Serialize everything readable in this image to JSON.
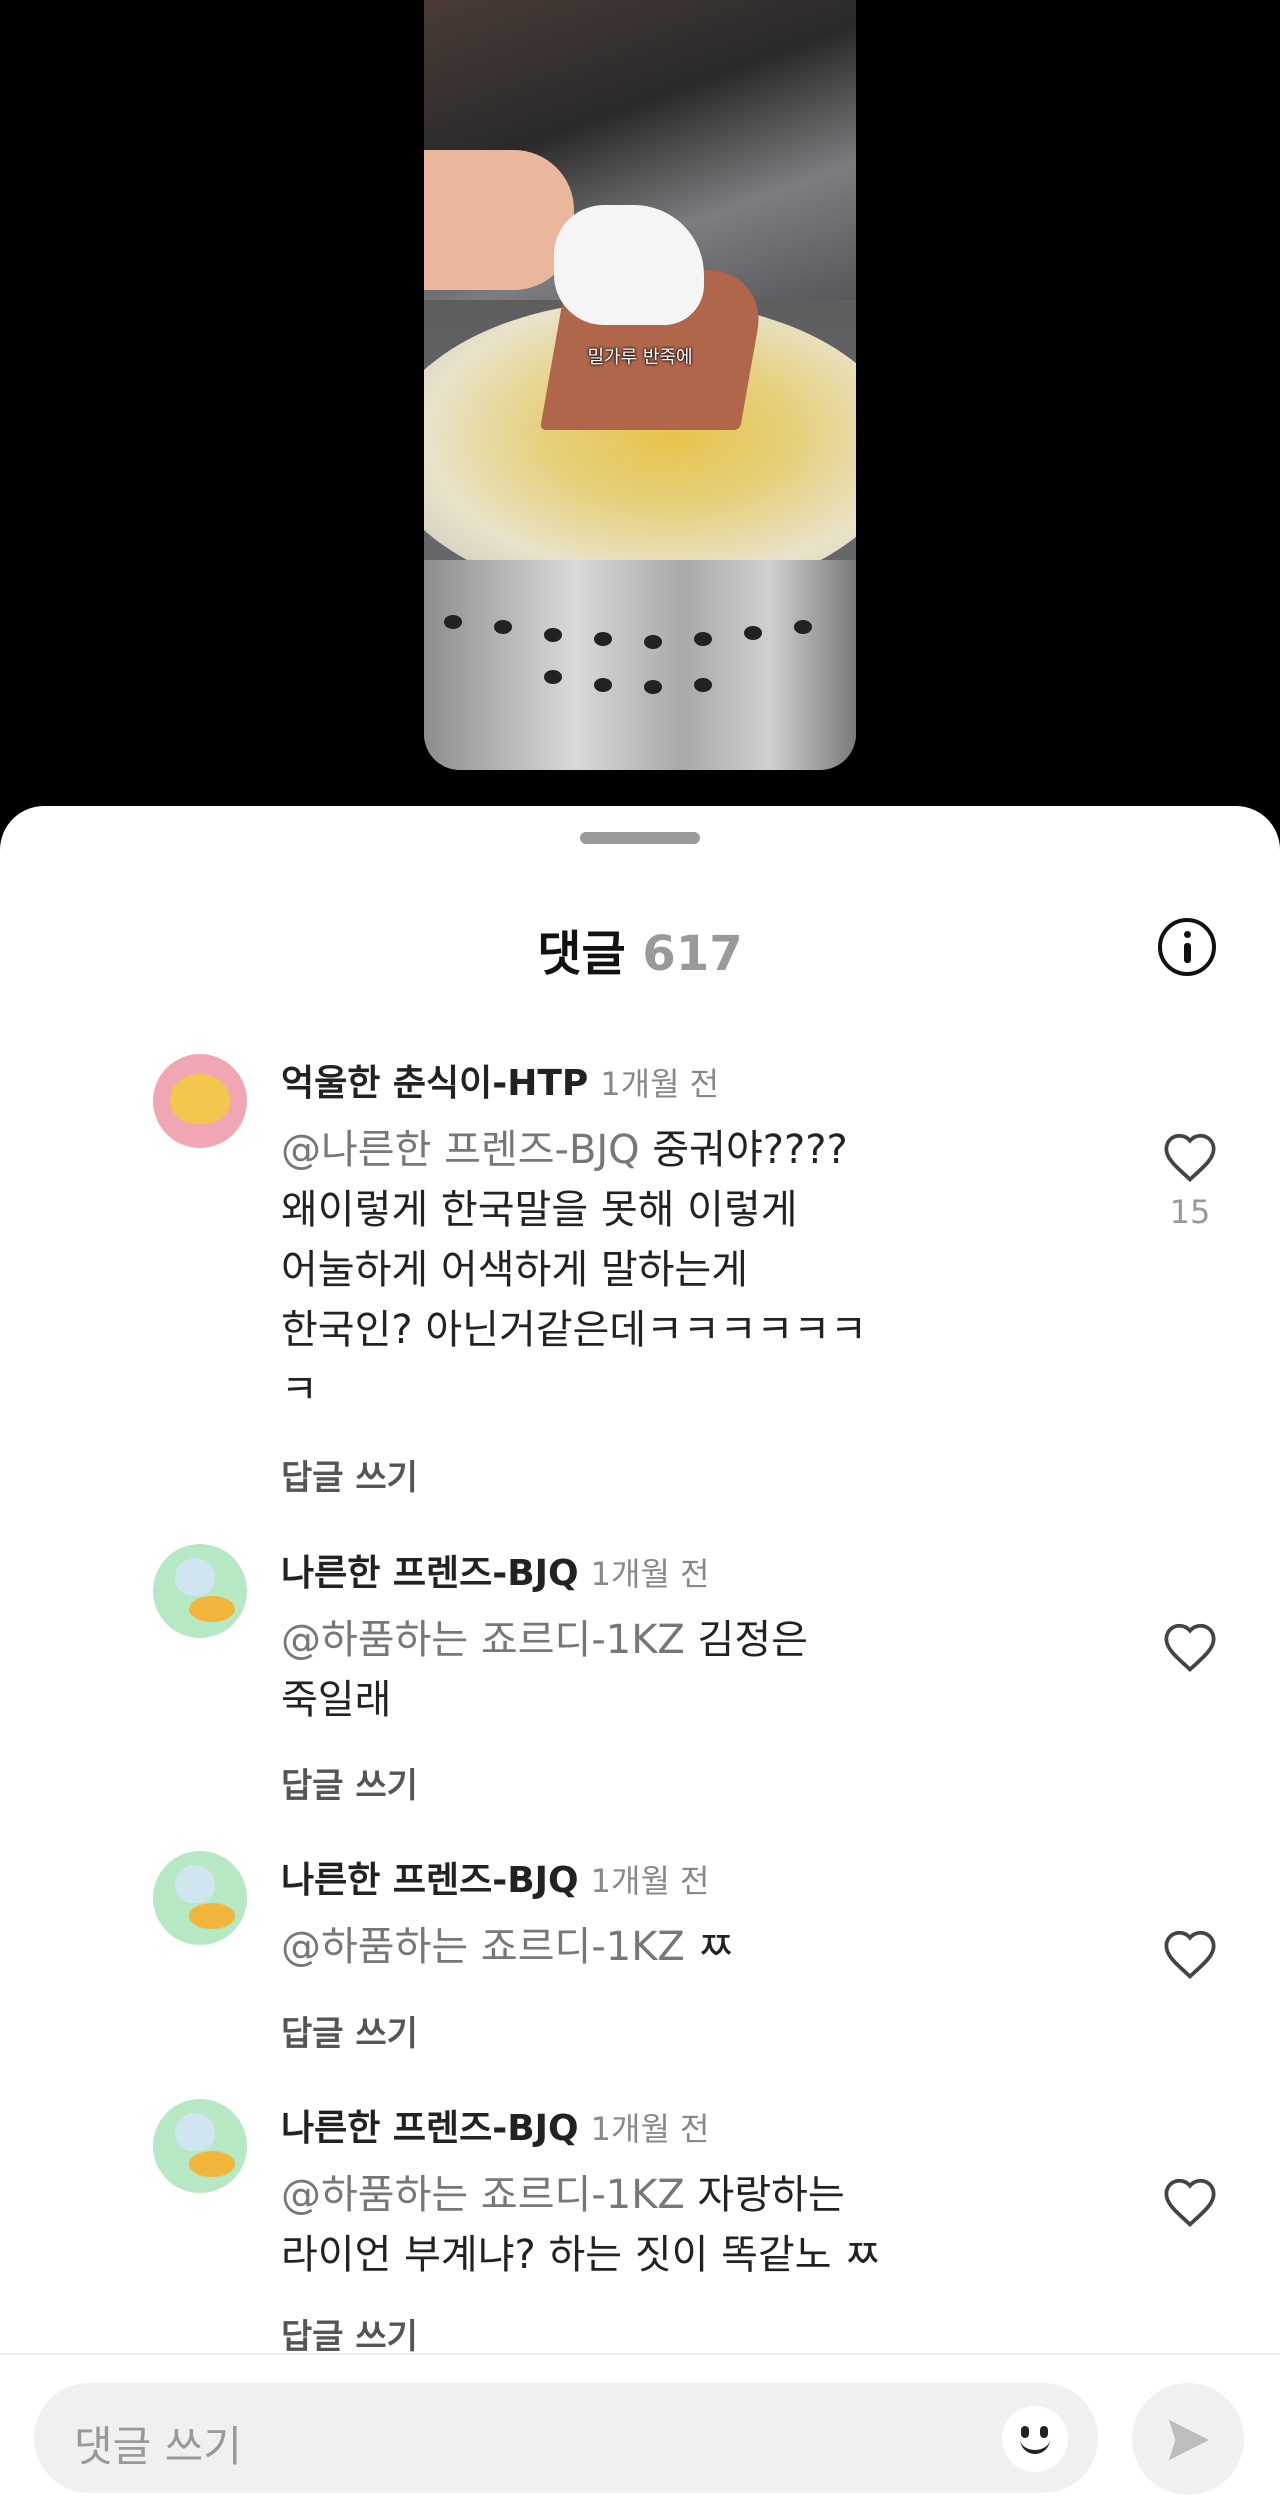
{
  "video": {
    "caption": "밀가루 반죽에"
  },
  "comments_sheet": {
    "title": "댓글",
    "count": "617",
    "comments": [
      {
        "author": "억울한 춘식이-HTP",
        "time": "1개월 전",
        "mention": "@나른한 프렌즈-BJQ",
        "text": " 중궈야????\n왜이렇게 한국말을 못해 이렇게\n어눌하게 어색하게 말하는게\n한국인? 아닌거같은데ㅋㅋㅋㅋㅋㅋ\nㅋ",
        "reply_label": "답글 쓰기",
        "like_count": "15"
      },
      {
        "author": "나른한 프렌즈-BJQ",
        "time": "1개월 전",
        "mention": "@하품하는 죠르디-1KZ",
        "text": " 김정은\n죽일래",
        "reply_label": "답글 쓰기"
      },
      {
        "author": "나른한 프렌즈-BJQ",
        "time": "1개월 전",
        "mention": "@하품하는 죠르디-1KZ",
        "text": " ㅉ",
        "reply_label": "답글 쓰기"
      },
      {
        "author": "나른한 프렌즈-BJQ",
        "time": "1개월 전",
        "mention": "@하품하는 죠르디-1KZ",
        "text": " 자랑하는\n라이언 부계냐? 하는 짓이 똑같노 ㅉ",
        "reply_label": "답글 쓰기"
      }
    ]
  },
  "input": {
    "placeholder": "댓글 쓰기"
  },
  "icons": {
    "info": "info-icon",
    "heart": "heart-outline-icon",
    "emoji": "smiley-icon",
    "send": "send-arrow-icon"
  }
}
